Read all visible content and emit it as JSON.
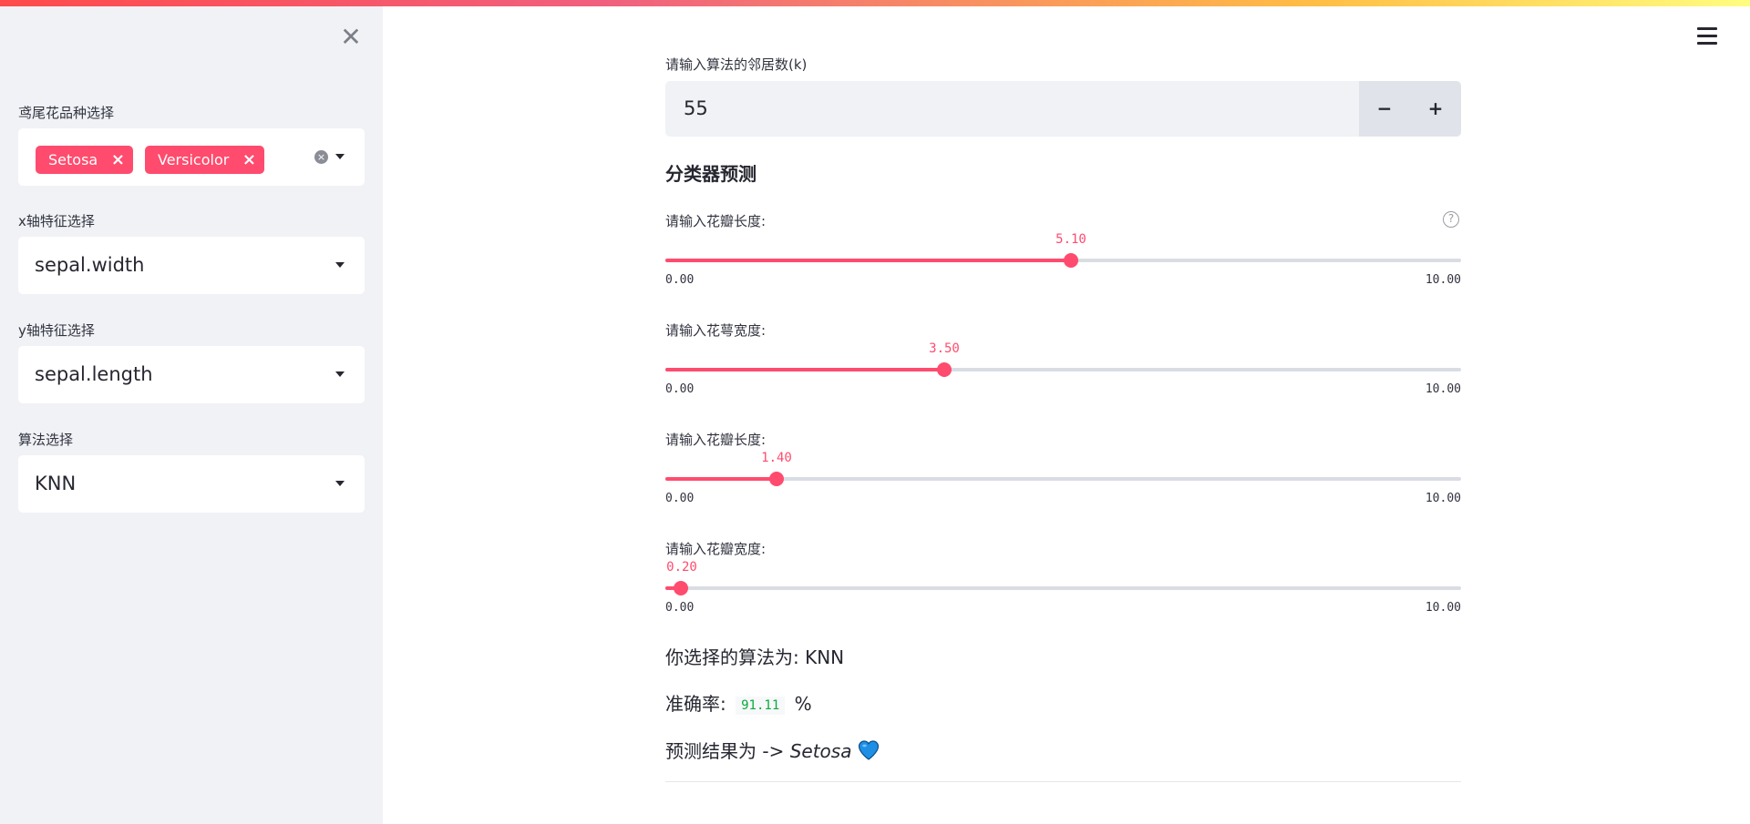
{
  "sidebar": {
    "close_label": "✕",
    "species": {
      "label": "鸢尾花品种选择",
      "tags": [
        "Setosa",
        "Versicolor"
      ],
      "clear_icon": "x-circle-icon"
    },
    "x_axis": {
      "label": "x轴特征选择",
      "value": "sepal.width"
    },
    "y_axis": {
      "label": "y轴特征选择",
      "value": "sepal.length"
    },
    "algorithm": {
      "label": "算法选择",
      "value": "KNN"
    }
  },
  "main": {
    "k_input": {
      "label": "请输入算法的邻居数(k)",
      "value": "55",
      "minus": "−",
      "plus": "+"
    },
    "section_title": "分类器预测",
    "sliders": [
      {
        "label": "请输入花瓣长度:",
        "value": "5.10",
        "fraction": 0.51,
        "min": "0.00",
        "max": "10.00"
      },
      {
        "label": "请输入花萼宽度:",
        "value": "3.50",
        "fraction": 0.35,
        "min": "0.00",
        "max": "10.00"
      },
      {
        "label": "请输入花瓣长度:",
        "value": "1.40",
        "fraction": 0.14,
        "min": "0.00",
        "max": "10.00"
      },
      {
        "label": "请输入花瓣宽度:",
        "value": "0.20",
        "fraction": 0.02,
        "min": "0.00",
        "max": "10.00"
      }
    ],
    "algo_line": "你选择的算法为: KNN",
    "accuracy": {
      "prefix": "准确率:",
      "value": "91.11",
      "suffix": "%"
    },
    "prediction": {
      "prefix": "预测结果为 ->",
      "value": "Setosa",
      "icon": "blue-heart-icon"
    }
  },
  "colors": {
    "accent": "#ff4b6e",
    "sidebar_bg": "#f0f2f6",
    "success": "#09ab3b"
  }
}
